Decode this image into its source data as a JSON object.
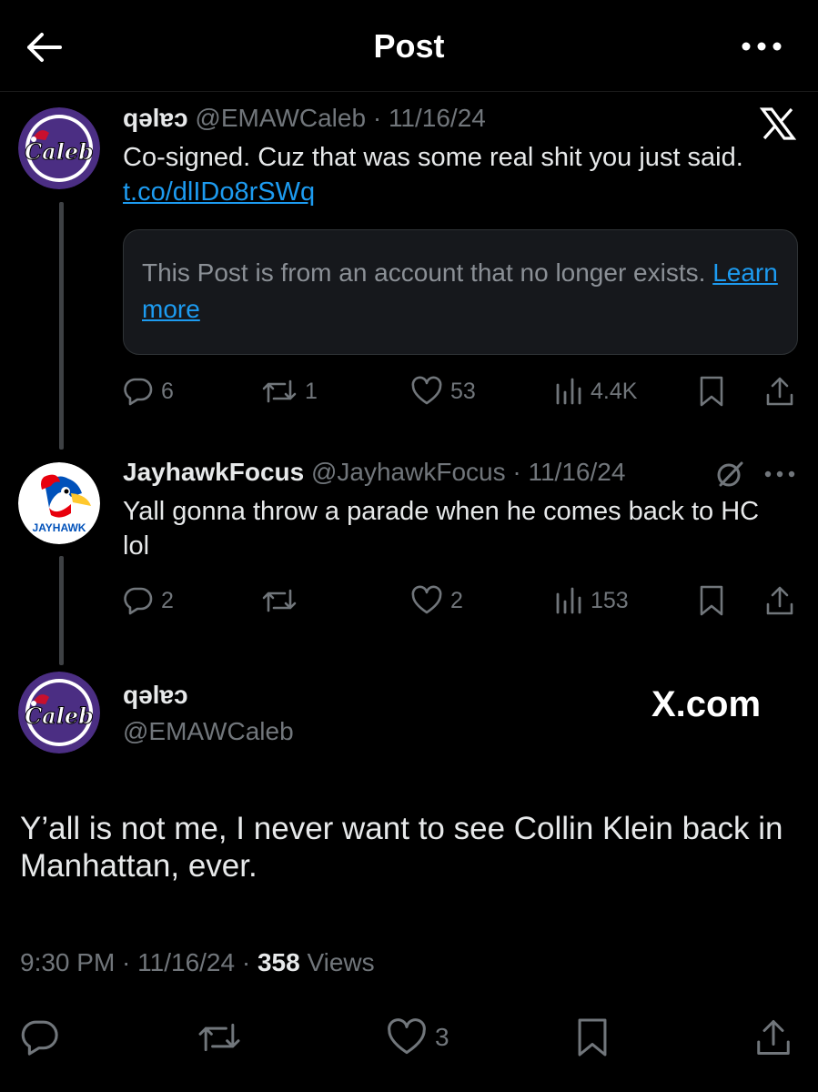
{
  "header": {
    "title": "Post"
  },
  "tweets": [
    {
      "display_name": "qəlɐɔ",
      "handle": "@EMAWCaleb",
      "sep": " · ",
      "date": "11/16/24",
      "text": "Co-signed. Cuz that was some real shit you just said. ",
      "link": "t.co/dlIDo8rSWq",
      "avatar_text": "Caleb",
      "embedded_notice": {
        "text": "This Post is from an account that no longer exists. ",
        "link": "Learn more"
      },
      "stats": {
        "replies": "6",
        "reposts": "1",
        "likes": "53",
        "views": "4.4K"
      }
    },
    {
      "display_name": "JayhawkFocus",
      "handle": "@JayhawkFocus",
      "sep": " · ",
      "date": "11/16/24",
      "text": "Yall gonna throw a parade when he comes back to HC lol",
      "avatar_text": "JAYHAWK",
      "stats": {
        "replies": "2",
        "reposts": "",
        "likes": "2",
        "views": "153"
      }
    }
  ],
  "main": {
    "display_name": "qəlɐɔ",
    "handle": "@EMAWCaleb",
    "avatar_text": "Caleb",
    "watermark": "X.com",
    "text": "Y’all is not me, I never want to see Collin Klein back in Manhattan, ever.",
    "time": "9:30 PM · 11/16/24 · ",
    "views_count": "358",
    "views_label": " Views",
    "likes": "3"
  },
  "icons": [
    "back-arrow-icon",
    "more-icon",
    "x-logo-icon",
    "reply-icon",
    "repost-icon",
    "like-icon",
    "views-icon",
    "bookmark-icon",
    "share-icon",
    "grok-icon"
  ],
  "colors": {
    "background": "#000000",
    "text": "#e7e9ea",
    "secondary": "#71767b",
    "link": "#1d9bf0",
    "avatar_purple": "#4b2e83"
  }
}
